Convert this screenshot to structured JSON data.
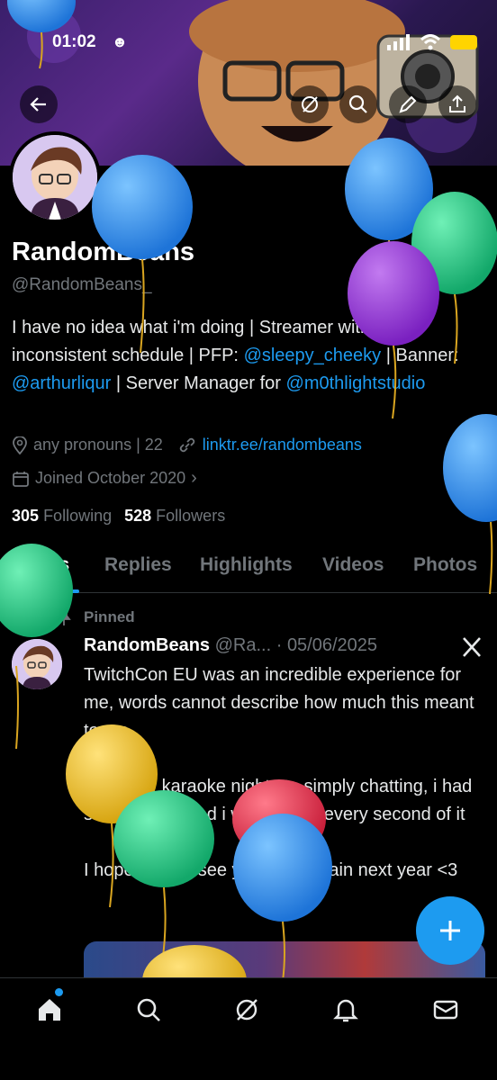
{
  "status_bar": {
    "time": "01:02"
  },
  "header": {
    "back_icon": "arrow-left-icon",
    "actions": [
      "grok-icon",
      "search-icon",
      "edit-icon",
      "share-icon"
    ]
  },
  "profile": {
    "name": "RandomBeans",
    "handle": "@RandomBeans_",
    "bio_pre": "I have no idea what i'm doing | Streamer with an inconsistent schedule | PFP: ",
    "bio_link1": "@sleepy_cheeky",
    "bio_mid1": " | Banner: ",
    "bio_link2": "@arthurliqur",
    "bio_mid2": " | Server Manager for ",
    "bio_link3": "@m0thlightstudio",
    "location": "any pronouns | 22",
    "website": "linktr.ee/randombeans",
    "joined": "Joined October 2020",
    "following_count": "305",
    "following_label": "Following",
    "followers_count": "528",
    "followers_label": "Followers"
  },
  "tabs": [
    "Posts",
    "Replies",
    "Highlights",
    "Videos",
    "Photos"
  ],
  "active_tab": "Posts",
  "post": {
    "pinned_label": "Pinned",
    "author": "RandomBeans",
    "handle_trunc": "@Ra...",
    "separator": "·",
    "date": "05/06/2025",
    "para1": "TwitchCon EU was an incredible experience for me, words cannot describe how much this meant to me",
    "para2": "From our karaoke nights to simply chatting, i had so much fun and i will cherish every second of it",
    "para3": "I hope i get to see you guys again next year <3"
  },
  "fab": {
    "icon": "plus-icon"
  },
  "bottom_nav": [
    "home-icon",
    "search-icon",
    "grok-icon",
    "notifications-icon",
    "messages-icon"
  ],
  "colors": {
    "accent": "#1d9bf0",
    "background": "#000000",
    "muted": "#71767b"
  }
}
